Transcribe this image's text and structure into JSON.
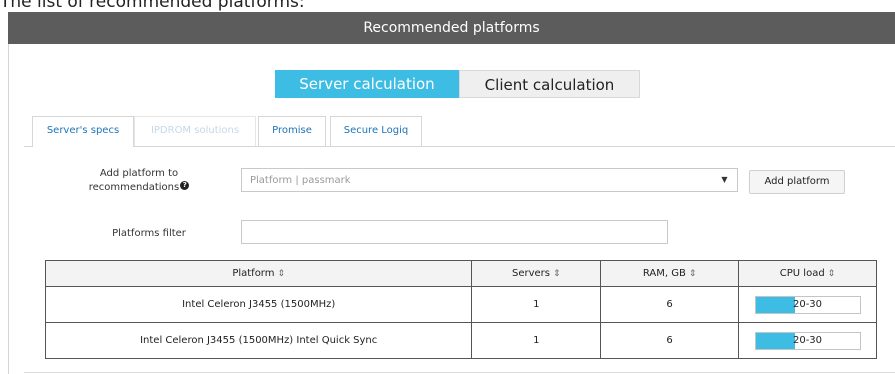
{
  "page_caption": "The list of recommended platforms:",
  "header": {
    "title": "Recommended platforms"
  },
  "calc_toggle": {
    "server_label": "Server calculation",
    "client_label": "Client calculation",
    "active": "server"
  },
  "tabs": [
    {
      "label": "Server's specs",
      "state": "active"
    },
    {
      "label": "IPDROM solutions",
      "state": "disabled"
    },
    {
      "label": "Promise",
      "state": "normal"
    },
    {
      "label": "Secure Logiq",
      "state": "normal"
    }
  ],
  "add_platform": {
    "label": "Add platform to recommendations",
    "help_icon": "question-circle-icon",
    "placeholder": "Platform | passmark",
    "value": "",
    "dropdown_icon": "caret-down-icon",
    "button_label": "Add platform"
  },
  "filter": {
    "label": "Platforms filter",
    "value": ""
  },
  "table": {
    "sort_icon": "sort-icon",
    "columns": [
      "Platform",
      "Servers",
      "RAM, GB",
      "CPU load"
    ],
    "rows": [
      {
        "platform": "Intel Celeron J3455 (1500MHz)",
        "servers": "1",
        "ram": "6",
        "cpu_load": "20-30",
        "cpu_fill_fraction": 0.38
      },
      {
        "platform": "Intel Celeron J3455 (1500MHz) Intel Quick Sync",
        "servers": "1",
        "ram": "6",
        "cpu_load": "20-30",
        "cpu_fill_fraction": 0.38
      }
    ]
  },
  "colors": {
    "header_bg": "#5c5c5c",
    "accent": "#3dbde3",
    "tab_link": "#1d74b9",
    "tab_disabled": "#c6d8e8"
  }
}
